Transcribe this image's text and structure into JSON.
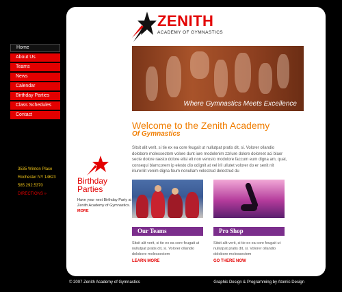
{
  "logo": {
    "title": "ZENITH",
    "subtitle": "ACADEMY OF GYMNASTICS"
  },
  "nav": {
    "items": [
      {
        "label": "Home"
      },
      {
        "label": "About Us"
      },
      {
        "label": "Teams"
      },
      {
        "label": "News"
      },
      {
        "label": "Calendar"
      },
      {
        "label": "Birthday Parties"
      },
      {
        "label": "Class Schedules"
      },
      {
        "label": "Contact"
      }
    ]
  },
  "address": {
    "street": "3535 Winton Place",
    "city": "Rochester NY 14623",
    "phone": "585.292.5370",
    "directions": "DIRECTIONS »"
  },
  "hero": {
    "caption": "Where Gymnastics Meets Excellence"
  },
  "welcome": {
    "title": "Welcome to the Zenith Academy",
    "subtitle": "Of Gymnastics",
    "body": "Sitsit alit verit, si tie ex ea core feugait ut nullutpat pratis dit, si. Volorer ollandio dolobore molessectem volore dunt iure modolenim zzriure dolore doloreet aci blaor secte dolore raesto dolore elisi elt non verosto modolore faccum eum digna am, quat, consequi blamcorem ip elesto dio odignit at vel iril ullutet volorer do er senit nit iriurerilit venim digna feum nonullam velestrud delestrud du"
  },
  "birthday": {
    "title_line1": "Birthday",
    "title_line2": "Parties",
    "body": "Have your next Birthday Party at Zenith Academy of Gymnastics.",
    "more": "MORE"
  },
  "teams": {
    "heading": "Our Teams",
    "body": "Sitsit alit verit, si tie ex ea core feugait ut nullutpat pratis dit, si. Volorer ollandio dolobore molessectem",
    "link": "LEARN MORE"
  },
  "shop": {
    "heading": "Pro Shop",
    "body": "Sitsit alit verit, si tie ex ea core feugait ut nullutpat pratis dit, si. Volorer ollandio dolobore molessectem",
    "link": "GO THERE NOW"
  },
  "footer": {
    "copyright": "© 2007 Zenith Academy of Gymnastics",
    "credit": "Graphic Design & Programming by Atomic Design"
  },
  "colors": {
    "accent_red": "#e30000",
    "orange": "#f07d00",
    "purple": "#7b2e8c",
    "gold": "#f0c419"
  }
}
